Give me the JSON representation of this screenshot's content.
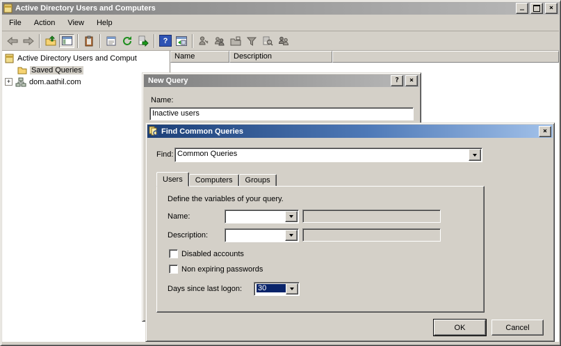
{
  "main_window": {
    "title": "Active Directory Users and Computers",
    "menu": [
      "File",
      "Action",
      "View",
      "Help"
    ],
    "columns": [
      "Name",
      "Description",
      ""
    ],
    "tree": {
      "root_label": "Active Directory Users and Comput",
      "saved_queries_label": "Saved Queries",
      "domain_label": "dom.aathil.com",
      "expander_glyph": "+"
    },
    "titlebar_buttons": {
      "minimize_glyph": "_",
      "close_glyph": "×"
    },
    "toolbar_icon_names": [
      "back-icon",
      "forward-icon",
      "up-one-level-icon",
      "console-tree-toggle-icon",
      "clipboard-icon",
      "properties-icon",
      "refresh-icon",
      "export-list-icon",
      "help-icon",
      "new-window-icon",
      "new-user-icon",
      "new-group-icon",
      "new-ou-icon",
      "set-filter-icon",
      "find-objects-icon",
      "add-to-group-icon"
    ]
  },
  "new_query_dialog": {
    "title": "New Query",
    "name_label": "Name:",
    "name_value": "Inactive users",
    "help_glyph": "?",
    "close_glyph": "×"
  },
  "find_dialog": {
    "title": "Find Common Queries",
    "find_label": "Find:",
    "find_value": "Common Queries",
    "tabs": [
      "Users",
      "Computers",
      "Groups"
    ],
    "active_tab": "Users",
    "define_label": "Define the variables of your query.",
    "name_label": "Name:",
    "description_label": "Description:",
    "checkbox_disabled_label": "Disabled accounts",
    "checkbox_nonexpiring_label": "Non expiring passwords",
    "days_label": "Days since last logon:",
    "days_value": "30",
    "ok_label": "OK",
    "cancel_label": "Cancel",
    "close_glyph": "×"
  },
  "colors": {
    "button_face": "#d4d0c8",
    "active_title_start": "#1c3f77",
    "active_title_end": "#a3c2ea",
    "inactive_title_start": "#7f7f7f",
    "inactive_title_end": "#b9b9b9",
    "selection": "#0a246a",
    "help_icon_blue": "#2f54b4"
  }
}
